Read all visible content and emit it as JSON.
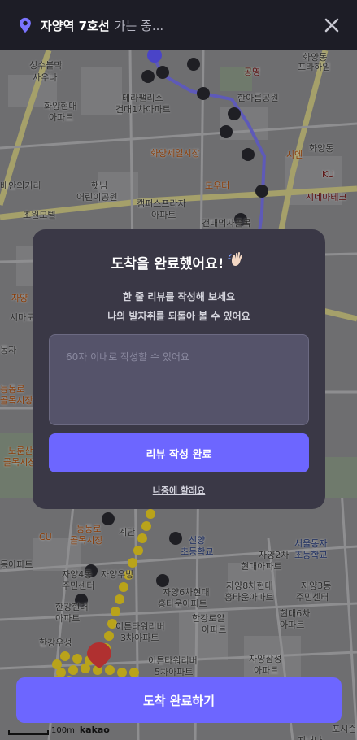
{
  "header": {
    "destination": "자양역 7호선",
    "status": "가는 중..."
  },
  "map": {
    "labels": [
      {
        "text": "성수불막",
        "cls": ""
      },
      {
        "text": "사우나",
        "cls": ""
      },
      {
        "text": "화양현대",
        "cls": ""
      },
      {
        "text": "아파트",
        "cls": ""
      },
      {
        "text": "테라팰리스",
        "cls": ""
      },
      {
        "text": "건대1차아파트",
        "cls": ""
      },
      {
        "text": "공영",
        "cls": "red"
      },
      {
        "text": "한아름공원",
        "cls": ""
      },
      {
        "text": "화양동",
        "cls": ""
      },
      {
        "text": "프라하임",
        "cls": ""
      },
      {
        "text": "화양제일시장",
        "cls": "orange"
      },
      {
        "text": "시엔",
        "cls": "orange"
      },
      {
        "text": "화양동",
        "cls": ""
      },
      {
        "text": "캠퍼스프라자",
        "cls": ""
      },
      {
        "text": "아파트",
        "cls": ""
      },
      {
        "text": "햇님",
        "cls": ""
      },
      {
        "text": "어린이공원",
        "cls": ""
      },
      {
        "text": "도우터",
        "cls": "orange"
      },
      {
        "text": "KU",
        "cls": "red"
      },
      {
        "text": "시네마테크",
        "cls": "red"
      },
      {
        "text": "건대먹자골목",
        "cls": ""
      },
      {
        "text": "배안의거리",
        "cls": ""
      },
      {
        "text": "초원모텔",
        "cls": ""
      },
      {
        "text": "자양",
        "cls": "orange"
      },
      {
        "text": "시마도",
        "cls": ""
      },
      {
        "text": "동자",
        "cls": ""
      },
      {
        "text": "능동로",
        "cls": "orange"
      },
      {
        "text": "골목시장",
        "cls": "orange"
      },
      {
        "text": "노룬산",
        "cls": "orange"
      },
      {
        "text": "골목시장",
        "cls": "orange"
      },
      {
        "text": "능동로",
        "cls": "orange"
      },
      {
        "text": "골목시장",
        "cls": "orange"
      },
      {
        "text": "CU",
        "cls": "orange"
      },
      {
        "text": "계단",
        "cls": ""
      },
      {
        "text": "신양",
        "cls": "blue"
      },
      {
        "text": "초등학교",
        "cls": "blue"
      },
      {
        "text": "서울동자",
        "cls": "blue"
      },
      {
        "text": "초등학교",
        "cls": "blue"
      },
      {
        "text": "동아파트",
        "cls": ""
      },
      {
        "text": "자양2차",
        "cls": ""
      },
      {
        "text": "현대아파트",
        "cls": ""
      },
      {
        "text": "자양4동",
        "cls": ""
      },
      {
        "text": "주민센터",
        "cls": ""
      },
      {
        "text": "자양우방",
        "cls": ""
      },
      {
        "text": "자양6차현대",
        "cls": ""
      },
      {
        "text": "홍타운아파트",
        "cls": ""
      },
      {
        "text": "자양8차현대",
        "cls": ""
      },
      {
        "text": "홍타운아파트",
        "cls": ""
      },
      {
        "text": "자양3동",
        "cls": ""
      },
      {
        "text": "주민센터",
        "cls": ""
      },
      {
        "text": "한강현대",
        "cls": ""
      },
      {
        "text": "아파트",
        "cls": ""
      },
      {
        "text": "이튼타워리버",
        "cls": ""
      },
      {
        "text": "3차아파트",
        "cls": ""
      },
      {
        "text": "한강로얄",
        "cls": ""
      },
      {
        "text": "아파트",
        "cls": ""
      },
      {
        "text": "현대6차",
        "cls": ""
      },
      {
        "text": "아파트",
        "cls": ""
      },
      {
        "text": "한강우성",
        "cls": ""
      },
      {
        "text": "이튼타워리버",
        "cls": ""
      },
      {
        "text": "5차아파트",
        "cls": ""
      },
      {
        "text": "자양삼성",
        "cls": ""
      },
      {
        "text": "아파트",
        "cls": ""
      },
      {
        "text": "포시즌",
        "cls": ""
      },
      {
        "text": "지내나",
        "cls": ""
      }
    ],
    "scale_text": "100m",
    "brand": "kakao"
  },
  "modal": {
    "title": "도착을 완료했어요!",
    "subtitle_line1": "한 줄 리뷰를 작성해 보세요",
    "subtitle_line2": "나의 발자취를 되돌아 볼 수 있어요",
    "review_placeholder": "60자 이내로 작성할 수 있어요",
    "submit_label": "리뷰 작성 완료",
    "later_label": "나중에 할래요"
  },
  "bottom": {
    "complete_label": "도착 완료하기"
  },
  "colors": {
    "accent": "#6d66ff",
    "topbar": "#1d1d26",
    "modal": "#3a3846",
    "pin": "#7b74ff"
  }
}
